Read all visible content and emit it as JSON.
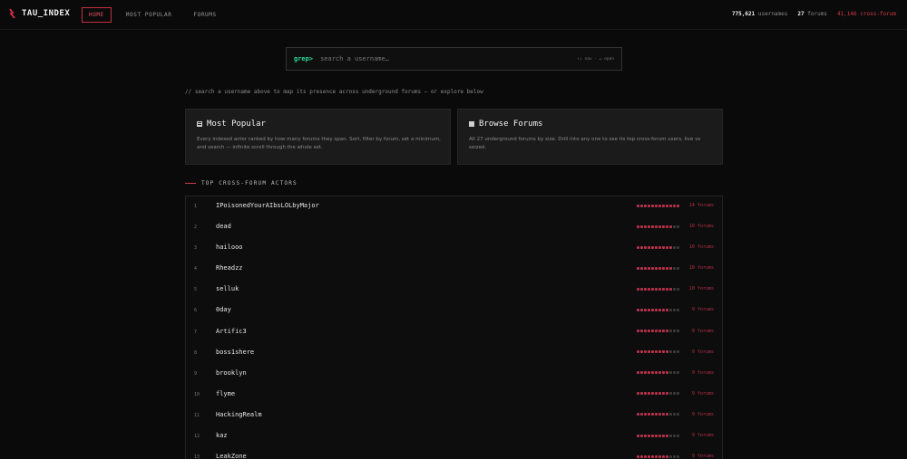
{
  "header": {
    "brand": "TAU_INDEX",
    "nav": [
      {
        "label": "HOME",
        "active": true
      },
      {
        "label": "MOST POPULAR",
        "active": false
      },
      {
        "label": "FORUMS",
        "active": false
      }
    ],
    "stats": [
      {
        "num": "775,621",
        "label": "usernames"
      },
      {
        "num": "27",
        "label": "forums"
      },
      {
        "num": "41,146",
        "label": "cross-forum"
      }
    ]
  },
  "search": {
    "prompt": "grep>",
    "placeholder": "search a username…",
    "hint": "↑↓ nav · ↵ open"
  },
  "hint_text": "// search a username above to map its presence across underground forums — or explore below",
  "cards": {
    "popular": {
      "title": "Most Popular",
      "icon": "grid-icon",
      "desc": "Every indexed actor ranked by how many forums they span. Sort, filter by forum, set a minimum, and search — infinite scroll through the whole set."
    },
    "forums": {
      "title": "Browse Forums",
      "icon": "square-icon",
      "desc": "All 27 underground forums by size. Drill into any one to see its top cross-forum users, live vs seized."
    }
  },
  "section_title": "TOP CROSS-FORUM ACTORS",
  "colors": {
    "accent": "#d13a4a",
    "prompt": "#2fd89a"
  },
  "dot_max": 12,
  "actors": [
    {
      "rank": "1",
      "name": "IPoisonedYourAIbsLOLbyMajor",
      "forums": 14,
      "count": "14 forums"
    },
    {
      "rank": "2",
      "name": "dead",
      "forums": 10,
      "count": "10 forums"
    },
    {
      "rank": "3",
      "name": "hailooo",
      "forums": 10,
      "count": "10 forums"
    },
    {
      "rank": "4",
      "name": "Rheadzz",
      "forums": 10,
      "count": "10 forums"
    },
    {
      "rank": "5",
      "name": "selluk",
      "forums": 10,
      "count": "10 forums"
    },
    {
      "rank": "6",
      "name": "0day",
      "forums": 9,
      "count": "9 forums"
    },
    {
      "rank": "7",
      "name": "Artific3",
      "forums": 9,
      "count": "9 forums"
    },
    {
      "rank": "8",
      "name": "boss1shere",
      "forums": 9,
      "count": "9 forums"
    },
    {
      "rank": "9",
      "name": "brooklyn",
      "forums": 9,
      "count": "9 forums"
    },
    {
      "rank": "10",
      "name": "flyme",
      "forums": 9,
      "count": "9 forums"
    },
    {
      "rank": "11",
      "name": "HackingRealm",
      "forums": 9,
      "count": "9 forums"
    },
    {
      "rank": "12",
      "name": "kaz",
      "forums": 9,
      "count": "9 forums"
    },
    {
      "rank": "13",
      "name": "LeakZone",
      "forums": 9,
      "count": "9 forums"
    }
  ]
}
